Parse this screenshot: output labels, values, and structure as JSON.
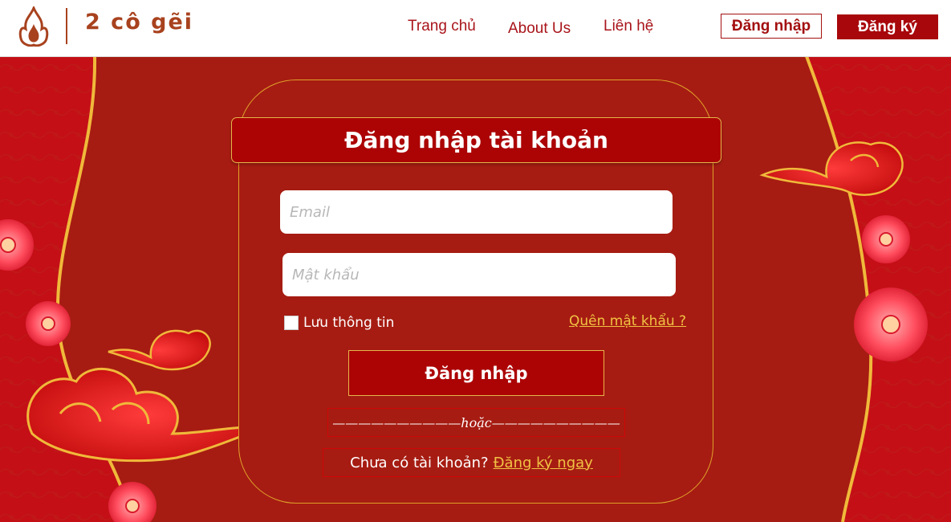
{
  "header": {
    "brand": "2 cô gẽi",
    "nav": [
      {
        "label": "Trang chủ"
      },
      {
        "label": "About Us"
      },
      {
        "label": "Liên hệ"
      }
    ],
    "login_label": "Đăng nhập",
    "register_label": "Đăng ký"
  },
  "form": {
    "title": "Đăng nhập tài khoản",
    "email_placeholder": "Email",
    "password_placeholder": "Mật khẩu",
    "remember_label": "Lưu thông tin",
    "remember_checked": false,
    "forgot_label": "Quên mật khẩu ?",
    "submit_label": "Đăng nhập",
    "divider_text": "——————————hoặc——————————",
    "no_account_text": "Chưa có tài khoản?",
    "signup_link": "Đăng ký ngay"
  },
  "colors": {
    "primary_red": "#ac0405",
    "background_red": "#a61c12",
    "gold": "#e6b54a",
    "link_gold": "#f1c243"
  },
  "icons": {
    "logo": "fire-logo-icon",
    "decor": [
      "red-flower-icon",
      "gold-cloud-icon"
    ]
  }
}
